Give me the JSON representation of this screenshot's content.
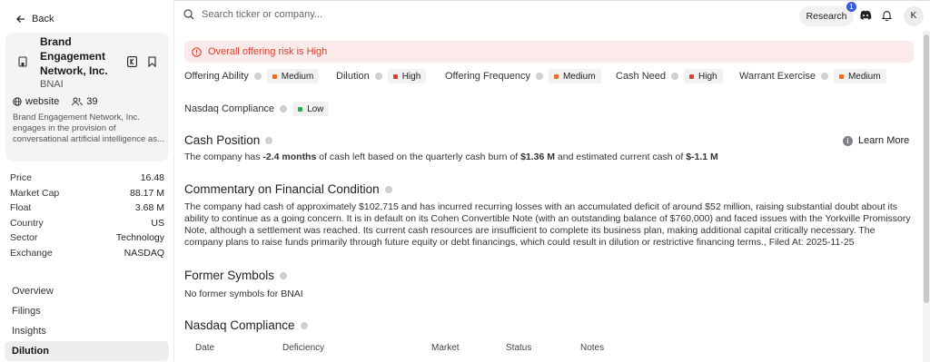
{
  "sidebar": {
    "back_label": "Back",
    "company": {
      "name": "Brand Engagement Network, Inc.",
      "ticker": "BNAI",
      "website_label": "website",
      "followers": "39",
      "description": "Brand Engagement Network, Inc. engages in the provision of conversational artificial intelligence as..."
    },
    "stats": [
      {
        "label": "Price",
        "value": "16.48"
      },
      {
        "label": "Market Cap",
        "value": "88.17 M"
      },
      {
        "label": "Float",
        "value": "3.68 M"
      },
      {
        "label": "Country",
        "value": "US"
      },
      {
        "label": "Sector",
        "value": "Technology"
      },
      {
        "label": "Exchange",
        "value": "NASDAQ"
      }
    ],
    "nav": [
      {
        "label": "Overview",
        "active": false
      },
      {
        "label": "Filings",
        "active": false
      },
      {
        "label": "Insights",
        "active": false
      },
      {
        "label": "Dilution",
        "active": true
      }
    ]
  },
  "topbar": {
    "search_placeholder": "Search ticker or company...",
    "research_label": "Research",
    "notification_count": "1",
    "avatar_initial": "K"
  },
  "main": {
    "alert": "Overall offering risk is High",
    "metrics": [
      {
        "label": "Offering Ability",
        "level": "Medium",
        "color": "#e8702a"
      },
      {
        "label": "Dilution",
        "level": "High",
        "color": "#d9412c"
      },
      {
        "label": "Offering Frequency",
        "level": "Medium",
        "color": "#e8702a"
      },
      {
        "label": "Cash Need",
        "level": "High",
        "color": "#d9412c"
      },
      {
        "label": "Warrant Exercise",
        "level": "Medium",
        "color": "#e8702a"
      },
      {
        "label": "Nasdaq Compliance",
        "level": "Low",
        "color": "#2fa84f"
      }
    ],
    "cash_position": {
      "title": "Cash Position",
      "learn_more": "Learn More",
      "text_1": "The company has ",
      "months": "-2.4 months",
      "text_2": " of cash left based on the quarterly cash burn of ",
      "burn": "$1.36 M",
      "text_3": " and estimated current cash of ",
      "cash": "$-1.1 M"
    },
    "commentary": {
      "title": "Commentary on Financial Condition",
      "text": "The company had cash of approximately $102,715 and has incurred recurring losses with an accumulated deficit of around $52 million, raising substantial doubt about its ability to continue as a going concern. It is in default on its Cohen Convertible Note (with an outstanding balance of $760,000) and faced issues with the Yorkville Promissory Note, although a settlement was reached. Its current cash resources are insufficient to complete its business plan, making additional capital critically necessary. The company plans to raise funds primarily through future equity or debt financings, which could result in dilution or restrictive financing terms., Filed At: 2025-11-25"
    },
    "former_symbols": {
      "title": "Former Symbols",
      "text": "No former symbols for BNAI"
    },
    "nasdaq": {
      "title": "Nasdaq Compliance",
      "columns": [
        "Date",
        "Deficiency",
        "Market",
        "Status",
        "Notes"
      ]
    }
  }
}
